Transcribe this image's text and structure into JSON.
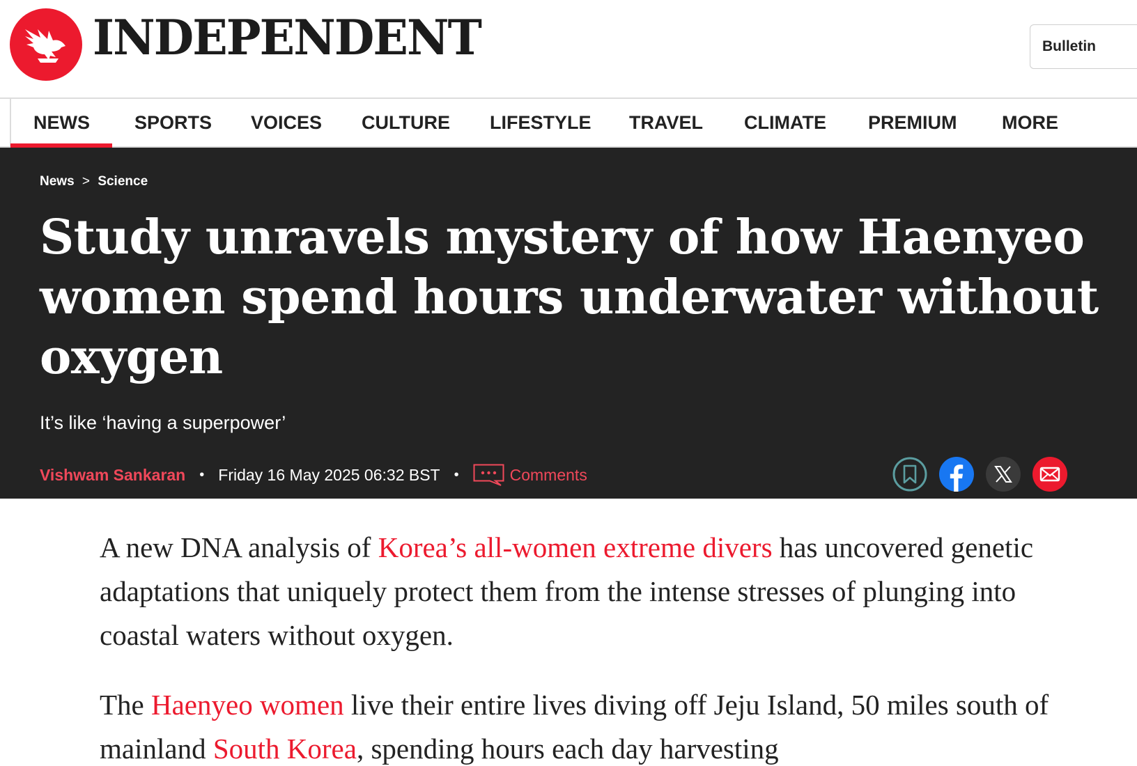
{
  "masthead": {
    "logo_icon": "eagle-icon",
    "brand_name": "INDEPENDENT",
    "bulletin_label": "Bulletin",
    "brand_color": "#ec1a2e"
  },
  "nav": {
    "items": [
      {
        "label": "NEWS",
        "active": true
      },
      {
        "label": "SPORTS"
      },
      {
        "label": "VOICES"
      },
      {
        "label": "CULTURE"
      },
      {
        "label": "LIFESTYLE"
      },
      {
        "label": "TRAVEL"
      },
      {
        "label": "CLIMATE"
      },
      {
        "label": "PREMIUM"
      },
      {
        "label": "MORE"
      }
    ]
  },
  "article": {
    "breadcrumb": [
      "News",
      "Science"
    ],
    "breadcrumb_separator": ">",
    "headline": "Study unravels mystery of how Haenyeo women spend hours underwater without oxygen",
    "standfirst": "It’s like ‘having a superpower’",
    "author": "Vishwam Sankaran",
    "date": "Friday 16 May 2025 06:32 BST",
    "comments_label": "Comments",
    "share_icons": [
      "bookmark-icon",
      "facebook-icon",
      "x-icon",
      "email-icon"
    ],
    "body": {
      "p1": {
        "pre": "A new DNA analysis of ",
        "link": "Korea’s all-women extreme divers",
        "post": " has uncovered genetic adaptations that uniquely protect them from the intense stresses of plunging into coastal waters without oxygen."
      },
      "p2": {
        "pre": "The ",
        "link1": "Haenyeo women",
        "mid": " live their entire lives diving off Jeju Island, 50 miles south of mainland ",
        "link2": "South Korea",
        "post": ", spending hours each day harvesting"
      }
    }
  }
}
